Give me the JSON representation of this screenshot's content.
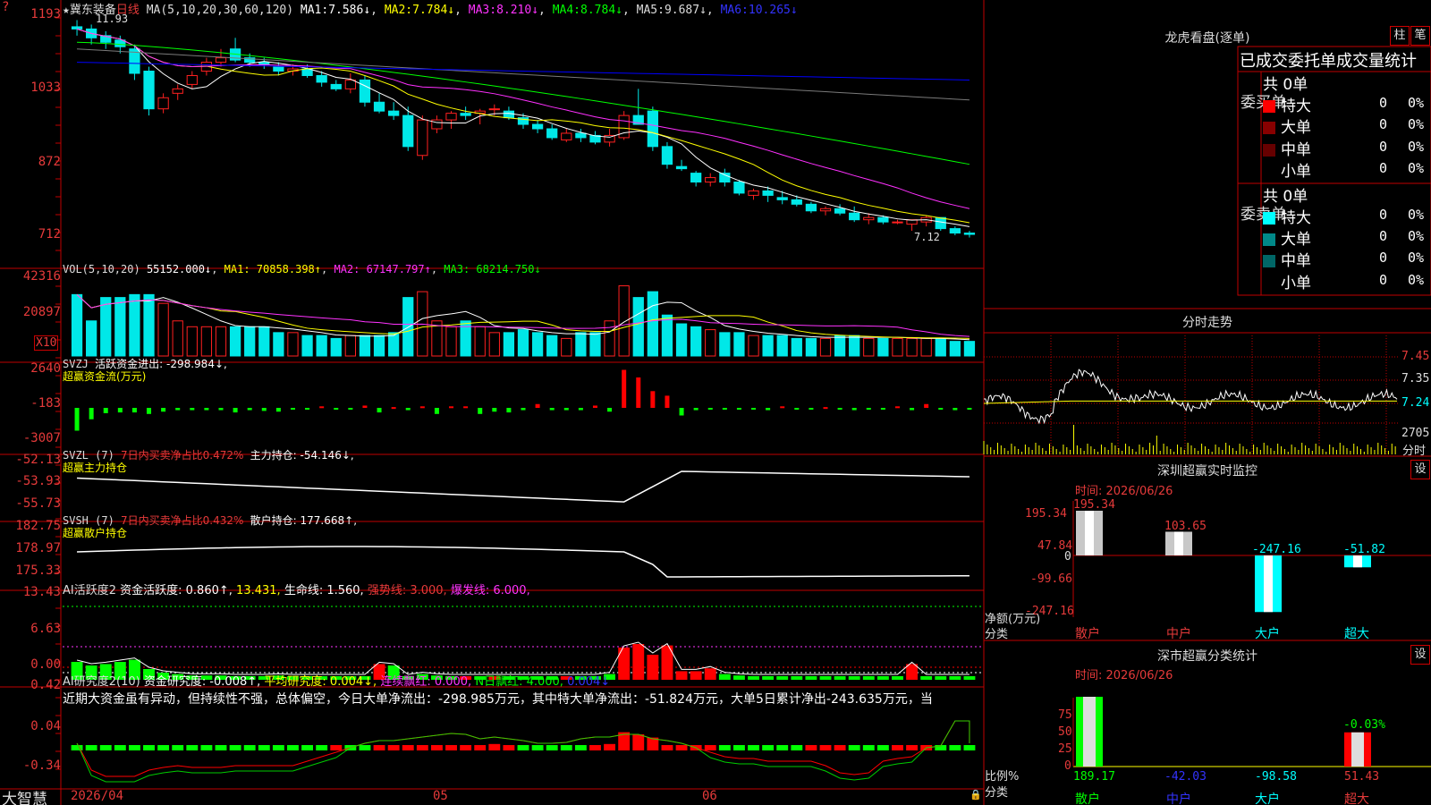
{
  "stock": {
    "name": "冀东装备",
    "period": "日线",
    "star": "★"
  },
  "status_bar": {
    "brand": "大智慧"
  },
  "colors": {
    "up": "#ff2020",
    "down": "#00e8e8",
    "ma1": "#ffffff",
    "ma2": "#ffff00",
    "ma3": "#ff30ff",
    "ma4": "#00ff00",
    "ma5": "#7a7a7a",
    "ma6": "#0000ff"
  },
  "main_chart": {
    "ma_title": "MA(5,10,20,30,60,120)",
    "ma_legend": [
      {
        "name": "MA1:",
        "value": "7.586↓"
      },
      {
        "name": "MA2:",
        "value": "7.784↓"
      },
      {
        "name": "MA3:",
        "value": "8.210↓"
      },
      {
        "name": "MA4:",
        "value": "8.784↓"
      },
      {
        "name": "MA5:",
        "value": "9.687↓"
      },
      {
        "name": "MA6:",
        "value": "10.265↓"
      }
    ],
    "y_ticks": [
      "1193",
      "1033",
      "872",
      "712"
    ],
    "high_marker": "11.93",
    "low_marker": "7.12"
  },
  "chart_data": [
    {
      "type": "candlestick",
      "title": "冀东装备 日线",
      "candles": [
        {
          "o": 11.8,
          "h": 11.95,
          "l": 11.6,
          "c": 11.75
        },
        {
          "o": 11.75,
          "h": 11.85,
          "l": 11.4,
          "c": 11.55
        },
        {
          "o": 11.6,
          "h": 11.7,
          "l": 11.3,
          "c": 11.45
        },
        {
          "o": 11.5,
          "h": 11.6,
          "l": 11.2,
          "c": 11.35
        },
        {
          "o": 11.3,
          "h": 11.4,
          "l": 10.6,
          "c": 10.75
        },
        {
          "o": 10.8,
          "h": 10.9,
          "l": 9.8,
          "c": 9.95
        },
        {
          "o": 9.95,
          "h": 10.3,
          "l": 9.85,
          "c": 10.2
        },
        {
          "o": 10.3,
          "h": 10.5,
          "l": 10.15,
          "c": 10.4
        },
        {
          "o": 10.5,
          "h": 10.8,
          "l": 10.4,
          "c": 10.7
        },
        {
          "o": 10.8,
          "h": 11.1,
          "l": 10.7,
          "c": 11.0
        },
        {
          "o": 11.0,
          "h": 11.3,
          "l": 10.9,
          "c": 11.1
        },
        {
          "o": 11.3,
          "h": 11.55,
          "l": 11.0,
          "c": 11.05
        },
        {
          "o": 11.1,
          "h": 11.2,
          "l": 10.9,
          "c": 11.0
        },
        {
          "o": 11.0,
          "h": 11.1,
          "l": 10.85,
          "c": 10.95
        },
        {
          "o": 10.9,
          "h": 11.0,
          "l": 10.7,
          "c": 10.8
        },
        {
          "o": 10.8,
          "h": 10.95,
          "l": 10.7,
          "c": 10.85
        },
        {
          "o": 10.85,
          "h": 10.95,
          "l": 10.65,
          "c": 10.7
        },
        {
          "o": 10.7,
          "h": 10.8,
          "l": 10.45,
          "c": 10.55
        },
        {
          "o": 10.5,
          "h": 10.6,
          "l": 10.35,
          "c": 10.4
        },
        {
          "o": 10.4,
          "h": 10.75,
          "l": 10.3,
          "c": 10.6
        },
        {
          "o": 10.6,
          "h": 10.7,
          "l": 10.0,
          "c": 10.1
        },
        {
          "o": 10.1,
          "h": 10.3,
          "l": 9.85,
          "c": 9.9
        },
        {
          "o": 9.9,
          "h": 10.1,
          "l": 9.7,
          "c": 9.8
        },
        {
          "o": 9.8,
          "h": 10.0,
          "l": 9.0,
          "c": 9.1
        },
        {
          "o": 8.9,
          "h": 9.8,
          "l": 8.8,
          "c": 9.7
        },
        {
          "o": 9.5,
          "h": 9.8,
          "l": 9.4,
          "c": 9.7
        },
        {
          "o": 9.7,
          "h": 9.9,
          "l": 9.5,
          "c": 9.85
        },
        {
          "o": 9.85,
          "h": 10.0,
          "l": 9.7,
          "c": 9.8
        },
        {
          "o": 9.85,
          "h": 9.95,
          "l": 9.6,
          "c": 9.9
        },
        {
          "o": 9.95,
          "h": 10.05,
          "l": 9.8,
          "c": 9.95
        },
        {
          "o": 9.9,
          "h": 10.0,
          "l": 9.7,
          "c": 9.75
        },
        {
          "o": 9.75,
          "h": 9.85,
          "l": 9.5,
          "c": 9.6
        },
        {
          "o": 9.6,
          "h": 9.7,
          "l": 9.4,
          "c": 9.5
        },
        {
          "o": 9.5,
          "h": 9.6,
          "l": 9.25,
          "c": 9.3
        },
        {
          "o": 9.25,
          "h": 9.5,
          "l": 9.2,
          "c": 9.4
        },
        {
          "o": 9.4,
          "h": 9.5,
          "l": 9.2,
          "c": 9.3
        },
        {
          "o": 9.35,
          "h": 9.45,
          "l": 9.15,
          "c": 9.2
        },
        {
          "o": 9.2,
          "h": 9.5,
          "l": 9.1,
          "c": 9.35
        },
        {
          "o": 9.3,
          "h": 9.9,
          "l": 9.25,
          "c": 9.8
        },
        {
          "o": 9.8,
          "h": 10.4,
          "l": 9.6,
          "c": 9.6
        },
        {
          "o": 9.9,
          "h": 10.0,
          "l": 9.0,
          "c": 9.1
        },
        {
          "o": 9.1,
          "h": 9.2,
          "l": 8.6,
          "c": 8.7
        },
        {
          "o": 8.65,
          "h": 8.8,
          "l": 8.55,
          "c": 8.6
        },
        {
          "o": 8.5,
          "h": 8.55,
          "l": 8.2,
          "c": 8.3
        },
        {
          "o": 8.3,
          "h": 8.5,
          "l": 8.2,
          "c": 8.4
        },
        {
          "o": 8.5,
          "h": 8.6,
          "l": 8.2,
          "c": 8.3
        },
        {
          "o": 8.3,
          "h": 8.35,
          "l": 8.0,
          "c": 8.05
        },
        {
          "o": 8.0,
          "h": 8.15,
          "l": 7.9,
          "c": 8.1
        },
        {
          "o": 8.1,
          "h": 8.2,
          "l": 7.85,
          "c": 8.0
        },
        {
          "o": 7.95,
          "h": 8.1,
          "l": 7.8,
          "c": 7.9
        },
        {
          "o": 7.9,
          "h": 8.0,
          "l": 7.75,
          "c": 7.8
        },
        {
          "o": 7.8,
          "h": 7.85,
          "l": 7.6,
          "c": 7.65
        },
        {
          "o": 7.65,
          "h": 7.75,
          "l": 7.55,
          "c": 7.7
        },
        {
          "o": 7.7,
          "h": 7.8,
          "l": 7.55,
          "c": 7.6
        },
        {
          "o": 7.6,
          "h": 7.75,
          "l": 7.4,
          "c": 7.45
        },
        {
          "o": 7.45,
          "h": 7.6,
          "l": 7.35,
          "c": 7.5
        },
        {
          "o": 7.5,
          "h": 7.55,
          "l": 7.35,
          "c": 7.4
        },
        {
          "o": 7.4,
          "h": 7.45,
          "l": 7.35,
          "c": 7.4
        },
        {
          "o": 7.35,
          "h": 7.45,
          "l": 7.2,
          "c": 7.45
        },
        {
          "o": 7.4,
          "h": 7.55,
          "l": 7.3,
          "c": 7.5
        },
        {
          "o": 7.5,
          "h": 7.5,
          "l": 7.2,
          "c": 7.25
        },
        {
          "o": 7.25,
          "h": 7.3,
          "l": 7.1,
          "c": 7.15
        },
        {
          "o": 7.15,
          "h": 7.2,
          "l": 7.05,
          "c": 7.12
        }
      ],
      "x_ticks": [
        "2026/04",
        "05",
        "06"
      ],
      "ylim": [
        7.0,
        12.0
      ]
    },
    {
      "type": "bar",
      "title": "VOL(5,10,20)",
      "legend": [
        "55152.000↓",
        "MA1: 70858.398↑",
        "MA2: 67147.797↑",
        "MA3: 68214.750↓"
      ],
      "y_ticks": [
        "42316",
        "20897"
      ],
      "unit": "X10",
      "values": [
        21,
        12,
        20,
        20,
        21,
        21,
        18,
        12,
        10,
        10,
        10,
        10,
        10,
        10,
        8,
        8,
        7,
        7,
        6,
        7,
        7,
        7,
        8,
        20,
        22,
        12,
        10,
        12,
        10,
        8,
        8,
        9,
        8,
        7,
        6,
        8,
        8,
        12,
        24,
        20,
        22,
        14,
        11,
        10,
        9,
        8,
        8,
        7,
        7,
        7,
        6,
        6,
        6,
        7,
        7,
        6,
        6,
        6,
        6,
        6,
        6,
        5,
        5
      ]
    },
    {
      "type": "bar",
      "title": "SVZJ",
      "legend": [
        "活跃资金进出: -298.984↓,",
        "超赢资金流(万元)"
      ],
      "y_ticks": [
        "2640",
        "-183",
        "-3007"
      ]
    },
    {
      "type": "line",
      "title": "SVZL (7)",
      "legend": [
        "7日内买卖净占比0.472%",
        "主力持仓: -54.146↓,",
        "超赢主力持仓"
      ],
      "y_ticks": [
        "-52.13",
        "-53.93",
        "-55.73"
      ]
    },
    {
      "type": "line",
      "title": "SVSH (7)",
      "legend": [
        "7日内买卖净占比0.432%",
        "散户持仓: 177.668↑,",
        "超赢散户持仓"
      ],
      "y_ticks": [
        "182.75",
        "178.97",
        "175.33"
      ]
    },
    {
      "type": "bar",
      "title": "AI活跃度2",
      "legend": [
        "资金活跃度: 0.860↑,",
        "13.431,",
        "生命线: 1.560,",
        "强势线: 3.000,",
        "爆发线: 6.000,"
      ],
      "y_ticks": [
        "13.43",
        "6.63",
        "0.00"
      ]
    },
    {
      "type": "bar",
      "title": "AI研究度2(10)",
      "legend": [
        "资金研究度: -0.008↑,",
        "平均研究度: 0.004↓,",
        "连续飘红: 0.000,",
        "N日飘红: 4.000,",
        "0.004↓"
      ],
      "y_ticks": [
        "0.42",
        "0.04",
        "-0.34"
      ],
      "commentary": "近期大资金虽有异动，但持续性不强，总体偏空，今日大单净流出：-298.985万元，其中特大单净流出：-51.824万元，大单5日累计净出-243.635万元，当"
    },
    {
      "type": "line",
      "title": "分时走势",
      "y_ticks": [
        "7.45",
        "7.35",
        "7.24",
        "2705"
      ],
      "x_label": "分时"
    },
    {
      "type": "bar",
      "title": "深圳超赢实时监控",
      "date": "时间: 2026/06/26",
      "categories": [
        "散户",
        "中户",
        "大户",
        "超大"
      ],
      "values": [
        195.34,
        103.65,
        -247.16,
        -51.82
      ],
      "value_labels": [
        "195.34",
        "103.65",
        "-247.16",
        "-51.82"
      ],
      "y_ticks": [
        "195.34",
        "47.84",
        "0",
        "-99.66",
        "-247.16"
      ],
      "ylabel": "净额(万元)",
      "xlabel": "分类"
    },
    {
      "type": "bar",
      "title": "深市超赢分类统计",
      "date": "时间: 2026/06/26",
      "categories": [
        "散户",
        "中户",
        "大户",
        "超大"
      ],
      "values": [
        189.17,
        -42.03,
        -98.58,
        51.43
      ],
      "bar_values": [
        100,
        0,
        0,
        49
      ],
      "top_label": "-0.03%",
      "y_ticks": [
        "75",
        "50",
        "25",
        "0"
      ],
      "ylabel": "比例%",
      "xlabel": "分类"
    }
  ],
  "dragon_tiger": {
    "title": "龙虎看盘(逐单)",
    "btn_pillar": "柱",
    "btn_stroke": "笔",
    "subtitle": "已成交委托单成交量统计",
    "buy": {
      "side_label": "委买单",
      "total": "共 0单",
      "rows": [
        {
          "name": "特大",
          "count": "0",
          "pct": "0%"
        },
        {
          "name": "大单",
          "count": "0",
          "pct": "0%"
        },
        {
          "name": "中单",
          "count": "0",
          "pct": "0%"
        },
        {
          "name": "小单",
          "count": "0",
          "pct": "0%"
        }
      ]
    },
    "sell": {
      "side_label": "委卖单",
      "total": "共 0单",
      "rows": [
        {
          "name": "特大",
          "count": "0",
          "pct": "0%"
        },
        {
          "name": "大单",
          "count": "0",
          "pct": "0%"
        },
        {
          "name": "中单",
          "count": "0",
          "pct": "0%"
        },
        {
          "name": "小单",
          "count": "0",
          "pct": "0%"
        }
      ]
    }
  },
  "settings_label": "设"
}
